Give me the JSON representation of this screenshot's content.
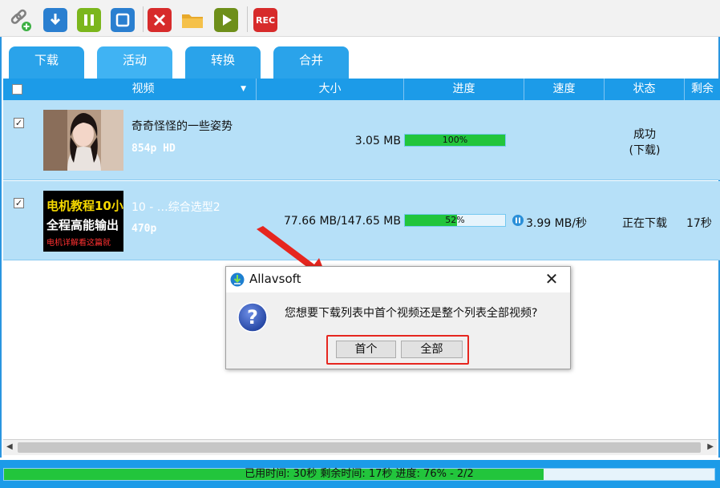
{
  "toolbar": {
    "rec_label": "REC"
  },
  "tabs": [
    {
      "label": "下载"
    },
    {
      "label": "活动"
    },
    {
      "label": "转换"
    },
    {
      "label": "合并"
    }
  ],
  "columns": {
    "video": "视频",
    "size": "大小",
    "progress": "进度",
    "speed": "速度",
    "status": "状态",
    "remaining": "剩余"
  },
  "rows": [
    {
      "checkbox": "✓",
      "title": "奇奇怪怪的一些姿势",
      "quality": "854p HD",
      "size": "3.05 MB",
      "progress": 100,
      "progress_label": "100%",
      "speed": "",
      "status_line1": "成功",
      "status_line2": "(下载)",
      "remaining": ""
    },
    {
      "checkbox": "✓",
      "thumb_line1": "电机教程10小",
      "thumb_line2": "全程高能输出",
      "thumb_line3": "电机详解看这篇就",
      "title": "10 - …综合选型2",
      "quality": "470p",
      "size": "77.66 MB/147.65 MB",
      "progress": 52,
      "progress_label": "52%",
      "speed": "3.99 MB/秒",
      "status_line1": "正在下载",
      "remaining": "17秒"
    }
  ],
  "statusbar": {
    "progress": 76,
    "text": "已用时间: 30秒  剩余时间: 17秒  进度: 76% - 2/2"
  },
  "dialog": {
    "title": "Allavsoft",
    "message": "您想要下载列表中首个视频还是整个列表全部视频?",
    "btn_first": "首个",
    "btn_all": "全部"
  },
  "colors": {
    "accent": "#1c9be8",
    "row_bg": "#b6e0f8",
    "progress_fill": "#22c53c",
    "annotation_red": "#e6261f"
  }
}
